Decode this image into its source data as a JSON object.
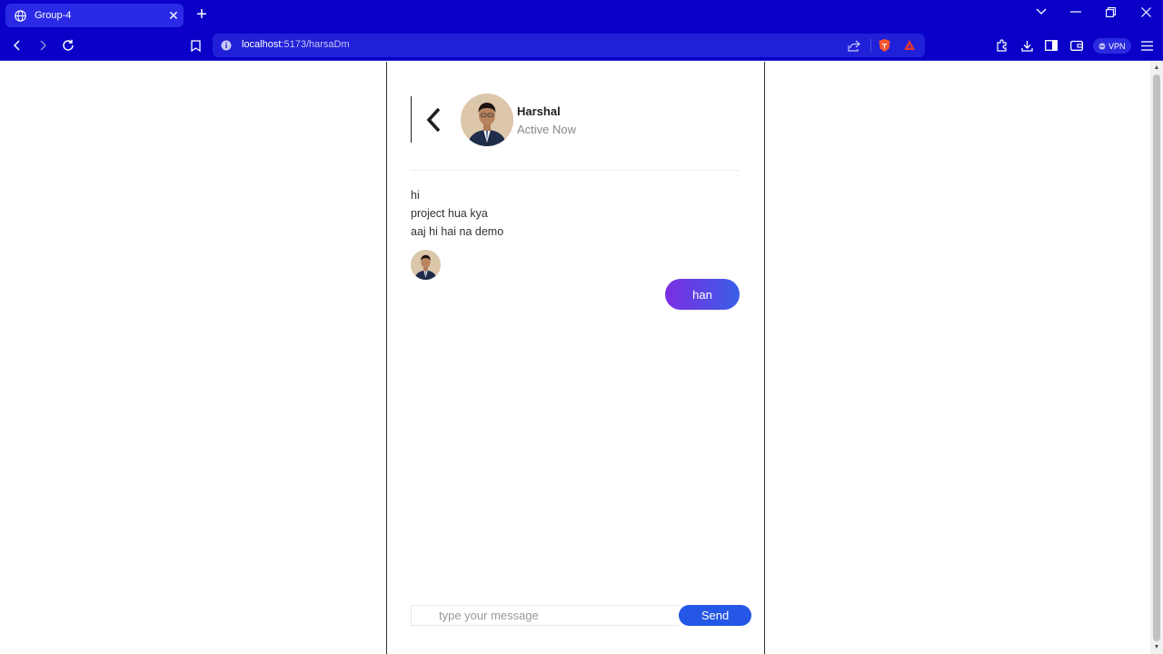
{
  "browser": {
    "tab_title": "Group-4",
    "tab_close": "✕",
    "new_tab": "+",
    "url_host": "localhost",
    "url_path": ":5173/harsaDm",
    "vpn_label": "VPN",
    "accent": "#0a00c7"
  },
  "chat": {
    "contact_name": "Harshal",
    "contact_status": "Active Now",
    "incoming_messages": [
      "hi",
      "project hua kya",
      "aaj hi hai na demo"
    ],
    "outgoing_message": "han",
    "input_placeholder": "type your message",
    "send_label": "Send",
    "send_color": "#2457e6"
  }
}
